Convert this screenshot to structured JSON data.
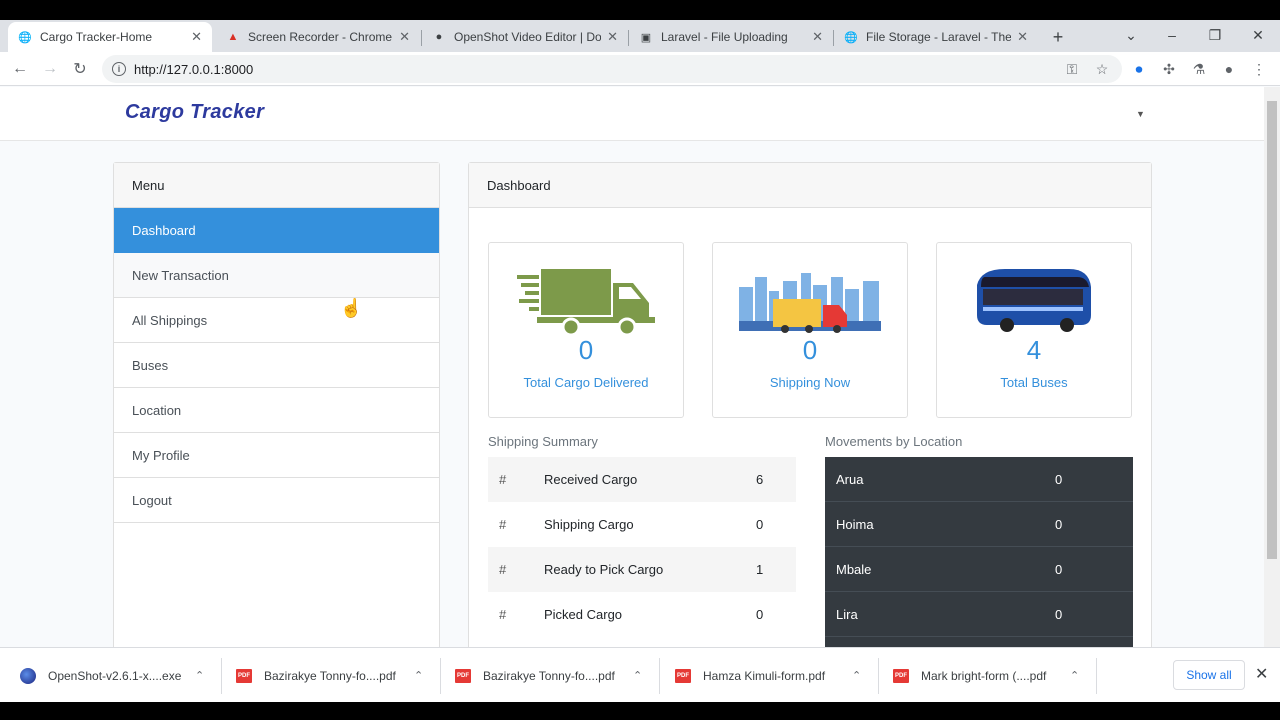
{
  "browser": {
    "tabs": [
      {
        "title": "Cargo Tracker-Home",
        "icon": "globe-icon",
        "close": "✕"
      },
      {
        "title": "Screen Recorder - Chrome W",
        "icon": "chrome-icon",
        "close": "✕"
      },
      {
        "title": "OpenShot Video Editor | Dov",
        "icon": "openshot-icon",
        "close": "✕"
      },
      {
        "title": "Laravel - File Uploading",
        "icon": "laravel-icon",
        "close": "✕"
      },
      {
        "title": "File Storage - Laravel - The P",
        "icon": "globe-icon",
        "close": "✕"
      }
    ],
    "new_tab": "+",
    "url": "http://127.0.0.1:8000"
  },
  "app": {
    "brand": "Cargo Tracker",
    "menu": {
      "title": "Menu",
      "items": [
        "Dashboard",
        "New Transaction",
        "All Shippings",
        "Buses",
        "Location",
        "My Profile",
        "Logout"
      ],
      "active": "Dashboard"
    },
    "dashboard": {
      "title": "Dashboard",
      "stats": [
        {
          "value": "0",
          "label": "Total Cargo Delivered",
          "icon": "truck-icon"
        },
        {
          "value": "0",
          "label": "Shipping Now",
          "icon": "city-truck-icon"
        },
        {
          "value": "4",
          "label": "Total Buses",
          "icon": "bus-icon"
        }
      ],
      "shipping_summary": {
        "title": "Shipping Summary",
        "rows": [
          {
            "hash": "#",
            "name": "Received Cargo",
            "value": "6"
          },
          {
            "hash": "#",
            "name": "Shipping Cargo",
            "value": "0"
          },
          {
            "hash": "#",
            "name": "Ready to Pick Cargo",
            "value": "1"
          },
          {
            "hash": "#",
            "name": "Picked Cargo",
            "value": "0"
          }
        ]
      },
      "movements": {
        "title": "Movements by Location",
        "rows": [
          {
            "name": "Arua",
            "value": "0"
          },
          {
            "name": "Hoima",
            "value": "0"
          },
          {
            "name": "Mbale",
            "value": "0"
          },
          {
            "name": "Lira",
            "value": "0"
          }
        ]
      }
    }
  },
  "downloads": {
    "items": [
      {
        "name": "OpenShot-v2.6.1-x....exe",
        "type": "exe"
      },
      {
        "name": "Bazirakye Tonny-fo....pdf",
        "type": "pdf"
      },
      {
        "name": "Bazirakye Tonny-fo....pdf",
        "type": "pdf"
      },
      {
        "name": "Hamza Kimuli-form.pdf",
        "type": "pdf"
      },
      {
        "name": "Mark bright-form (....pdf",
        "type": "pdf"
      }
    ],
    "pdf_badge": "PDF",
    "show_all": "Show all"
  },
  "colors": {
    "primary": "#3490dc",
    "brand": "#2d3a9e",
    "dark_table": "#343a40",
    "truck_green": "#7d9a4a"
  }
}
